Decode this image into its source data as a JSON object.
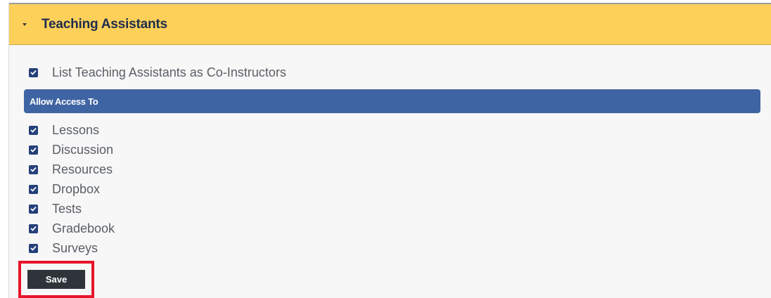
{
  "panel": {
    "title": "Teaching Assistants",
    "expanded": true
  },
  "co_instructors": {
    "label": "List Teaching Assistants as Co-Instructors",
    "checked": true
  },
  "access_section": {
    "title": "Allow Access To",
    "items": [
      {
        "label": "Lessons",
        "checked": true
      },
      {
        "label": "Discussion",
        "checked": true
      },
      {
        "label": "Resources",
        "checked": true
      },
      {
        "label": "Dropbox",
        "checked": true
      },
      {
        "label": "Tests",
        "checked": true
      },
      {
        "label": "Gradebook",
        "checked": true
      },
      {
        "label": "Surveys",
        "checked": true
      }
    ]
  },
  "actions": {
    "save_label": "Save"
  },
  "colors": {
    "header_bg": "#fdd05a",
    "section_bar": "#3f64a3",
    "checkbox": "#25407a",
    "save_button": "#2f333a",
    "highlight_outline": "#e8142c"
  },
  "icons": {
    "caret": "caret-down-icon",
    "check": "checkmark-icon"
  }
}
